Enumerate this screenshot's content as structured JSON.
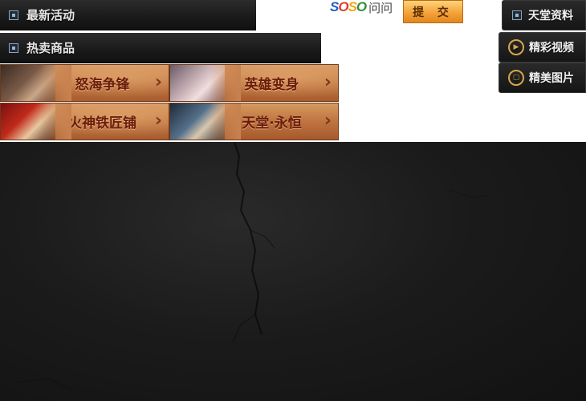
{
  "left_menu": {
    "latest_events": {
      "label": "最新活动",
      "icon": "square-bullet-icon"
    },
    "hot_items": {
      "label": "热卖商品",
      "icon": "square-bullet-icon"
    }
  },
  "search": {
    "logo_letters": [
      "S",
      "O",
      "S",
      "O"
    ],
    "logo_suffix": "问问",
    "submit_label": "提 交"
  },
  "right_nav": [
    {
      "label": "天堂资料",
      "icon": "square-bullet-icon"
    },
    {
      "label": "精彩视频",
      "icon": "play-icon"
    },
    {
      "label": "精美图片",
      "icon": "picture-icon"
    }
  ],
  "banners": [
    {
      "label": "怒海争锋",
      "icon": "chevron-right-icon"
    },
    {
      "label": "英雄变身",
      "icon": "chevron-right-icon"
    },
    {
      "label": "火神铁匠铺",
      "icon": "chevron-right-icon"
    },
    {
      "label": "天堂·永恒",
      "icon": "chevron-right-icon"
    }
  ],
  "colors": {
    "dark_bar": "#1a1a1a",
    "banner_text": "#6a1d0a",
    "submit_button": "#f3a33a",
    "accent_gold": "#d8a64a"
  }
}
